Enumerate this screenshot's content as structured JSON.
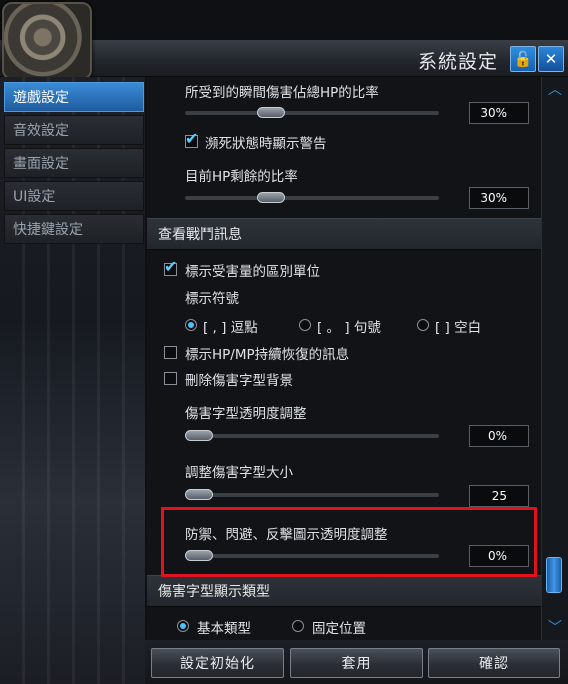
{
  "window": {
    "title": "系統設定"
  },
  "sidebar": {
    "items": [
      {
        "label": "遊戲設定",
        "active": true
      },
      {
        "label": "音效設定",
        "active": false
      },
      {
        "label": "畫面設定",
        "active": false
      },
      {
        "label": "UI設定",
        "active": false
      },
      {
        "label": "快捷鍵設定",
        "active": false
      }
    ]
  },
  "content": {
    "hp_instant_ratio": {
      "label": "所受到的瞬間傷害佔總HP的比率",
      "value": "30%",
      "level": 0.3
    },
    "dying_warning": {
      "label": "瀕死狀態時顯示警告",
      "checked": true
    },
    "hp_remaining_ratio": {
      "label": "目前HP剩餘的比率",
      "value": "30%",
      "level": 0.3
    },
    "combat_section": {
      "header": "查看戰鬥訊息",
      "show_damage_units": {
        "label": "標示受害量的區別單位",
        "checked": true
      },
      "symbol_label": "標示符號",
      "symbol_options": [
        {
          "label": "[ , ] 逗點",
          "selected": true
        },
        {
          "label": "[ 。 ] 句號",
          "selected": false
        },
        {
          "label": "[ ] 空白",
          "selected": false
        }
      ],
      "show_hpmp_recovery": {
        "label": "標示HP/MP持續恢復的訊息",
        "checked": false
      },
      "remove_damage_bg": {
        "label": "刪除傷害字型背景",
        "checked": false
      },
      "damage_font_opacity": {
        "label": "傷害字型透明度調整",
        "value": "0%",
        "level": 0.0
      },
      "damage_font_size": {
        "label": "調整傷害字型大小",
        "value": "25",
        "level": 0.0
      },
      "defense_icon_opacity": {
        "label": "防禦、閃避、反擊圖示透明度調整",
        "value": "0%",
        "level": 0.0
      }
    },
    "font_display_section": {
      "header": "傷害字型顯示類型",
      "options": [
        {
          "label": "基本類型",
          "selected": true
        },
        {
          "label": "固定位置",
          "selected": false
        }
      ]
    }
  },
  "buttons": {
    "reset": "設定初始化",
    "apply": "套用",
    "confirm": "確認"
  },
  "colors": {
    "accent": "#2e8ee0",
    "highlight": "#e0121d",
    "check": "#5ad0ff"
  }
}
